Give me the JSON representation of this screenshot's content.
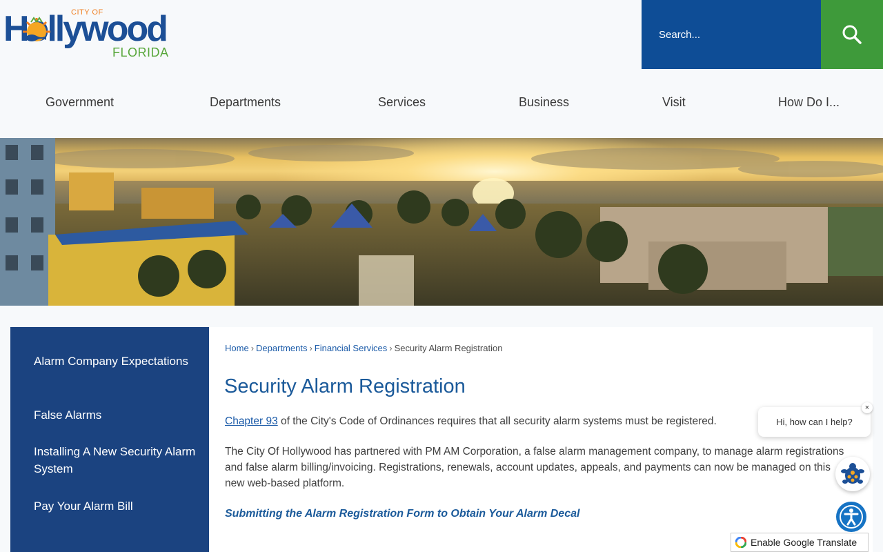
{
  "header": {
    "logo": {
      "city_of": "CITY OF",
      "wordmark": "Hollywood",
      "state": "FLORIDA"
    },
    "search": {
      "placeholder": "Search...",
      "button_icon": "search-icon"
    }
  },
  "nav": {
    "items": [
      {
        "label": "Government"
      },
      {
        "label": "Departments"
      },
      {
        "label": "Services"
      },
      {
        "label": "Business"
      },
      {
        "label": "Visit"
      },
      {
        "label": "How Do I..."
      }
    ]
  },
  "sidebar": {
    "items": [
      {
        "label": "Alarm Company Expectations"
      },
      {
        "label": "False Alarms"
      },
      {
        "label": "Installing A New Security Alarm System"
      },
      {
        "label": "Pay Your Alarm Bill"
      }
    ]
  },
  "breadcrumb": {
    "home": "Home",
    "departments": "Departments",
    "financial_services": "Financial Services",
    "current": "Security Alarm Registration",
    "separator": "›"
  },
  "main": {
    "title": "Security Alarm Registration",
    "p1_link": "Chapter 93",
    "p1_text": " of the City's Code of Ordinances requires that all security alarm systems must be registered.",
    "p2": "The City Of Hollywood has partnered with PM AM Corporation, a false alarm management company, to manage alarm registrations and false alarm billing/invoicing. Registrations, renewals, account updates, appeals, and payments can now be managed on this new web-based platform.",
    "subheading": "Submitting the Alarm Registration Form to Obtain Your Alarm Decal"
  },
  "chat": {
    "greeting": "Hi, how can I help?",
    "close": "×"
  },
  "translate": {
    "label": "Enable Google Translate"
  },
  "colors": {
    "brand_blue": "#0e4d96",
    "brand_green": "#3e9a3a",
    "sidebar_bg": "#1b4380",
    "title_blue": "#1b5a9a",
    "link_blue": "#1a5aa8",
    "logo_orange": "#f07d1e"
  }
}
